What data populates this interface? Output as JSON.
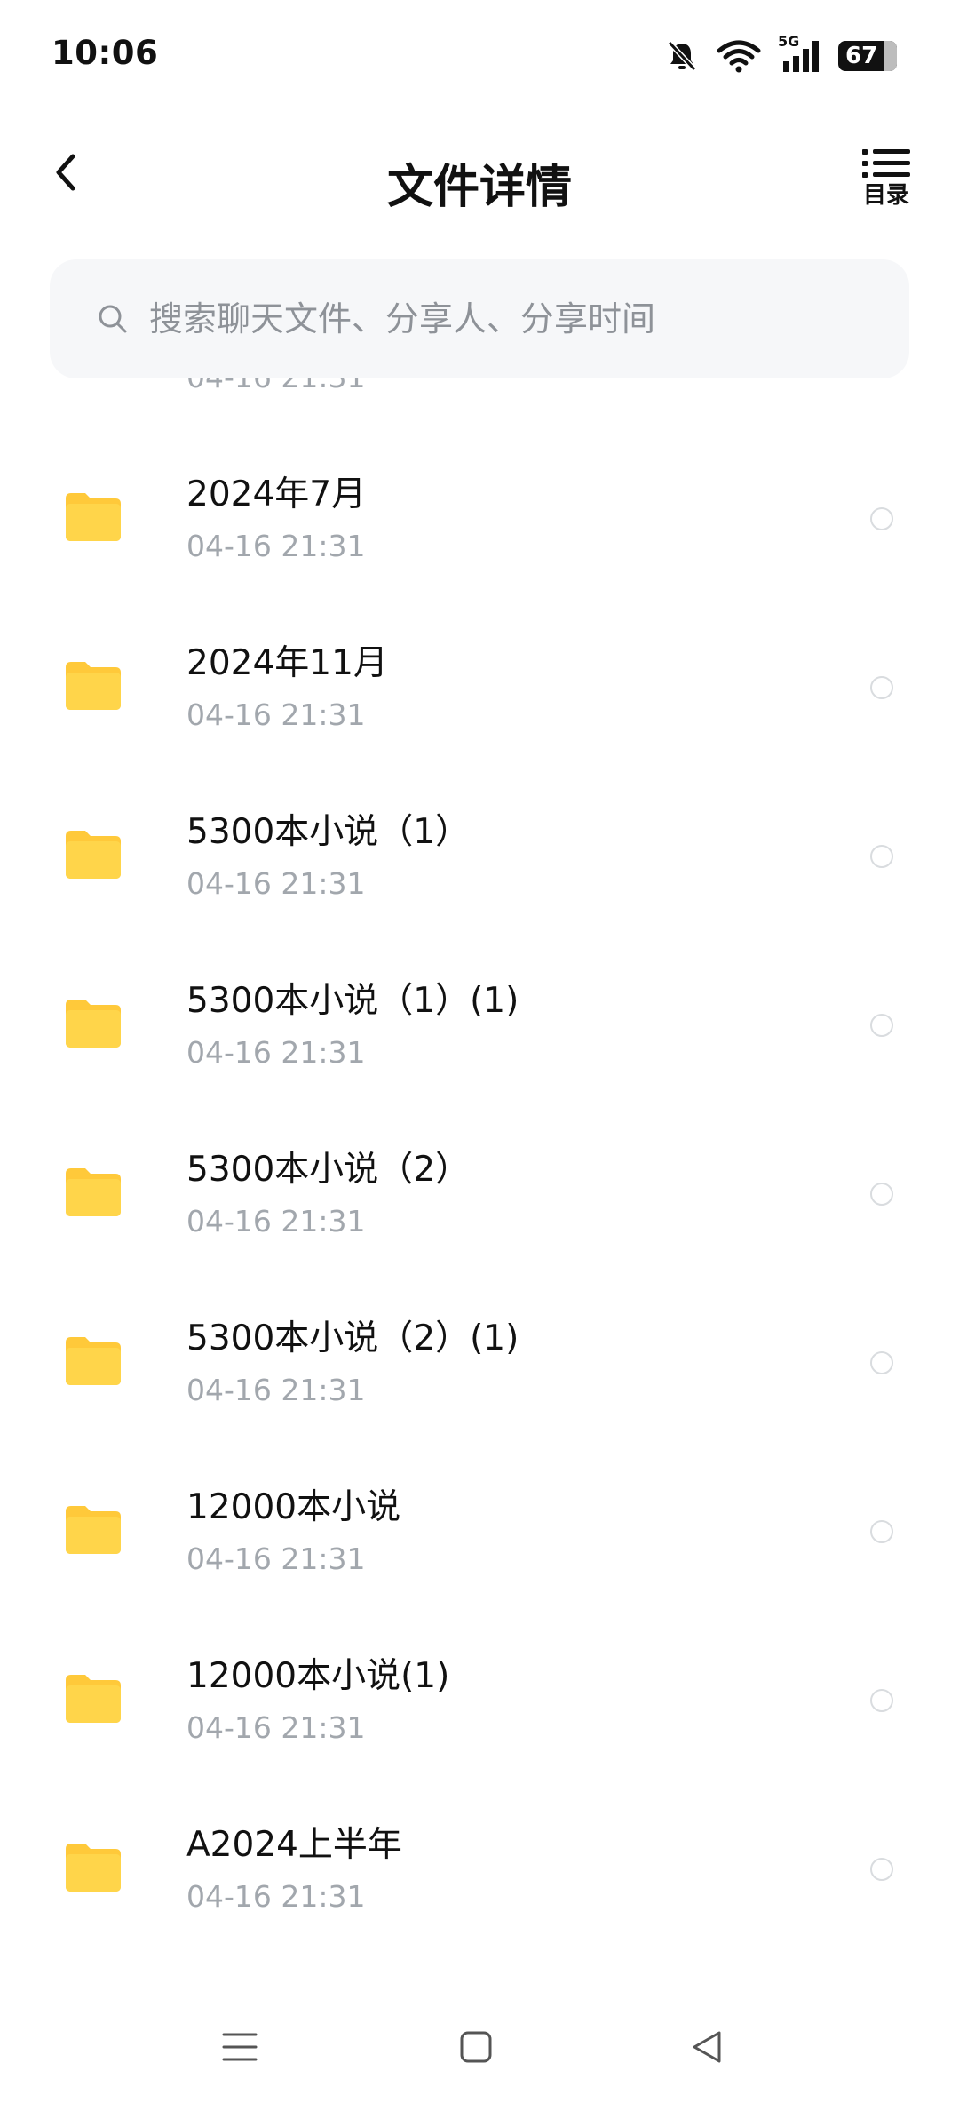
{
  "status_bar": {
    "time": "10:06",
    "network": "5G",
    "battery": "67",
    "icons": [
      "bell-muted-icon",
      "wifi-icon",
      "signal-5g-icon",
      "battery-icon"
    ]
  },
  "header": {
    "title": "文件详情",
    "toc_label": "目录",
    "back_icon": "chevron-left-icon"
  },
  "search": {
    "placeholder": "搜索聊天文件、分享人、分享时间"
  },
  "files": [
    {
      "name": "",
      "date": "04-16  21:31"
    },
    {
      "name": "2024年7月",
      "date": "04-16  21:31"
    },
    {
      "name": "2024年11月",
      "date": "04-16  21:31"
    },
    {
      "name": "5300本小说（1）",
      "date": "04-16  21:31"
    },
    {
      "name": "5300本小说（1）(1)",
      "date": "04-16  21:31"
    },
    {
      "name": "5300本小说（2）",
      "date": "04-16  21:31"
    },
    {
      "name": "5300本小说（2）(1)",
      "date": "04-16  21:31"
    },
    {
      "name": "12000本小说",
      "date": "04-16  21:31"
    },
    {
      "name": "12000本小说(1)",
      "date": "04-16  21:31"
    },
    {
      "name": "A2024上半年",
      "date": "04-16  21:31"
    }
  ],
  "colors": {
    "folder": "#FFD54A",
    "folder_tab": "#FFC93A",
    "date_text": "#A2A7AD",
    "search_bg": "#F6F7F9"
  },
  "nav_bar": {
    "icons": [
      "menu-icon",
      "home-square-icon",
      "back-triangle-icon"
    ]
  }
}
